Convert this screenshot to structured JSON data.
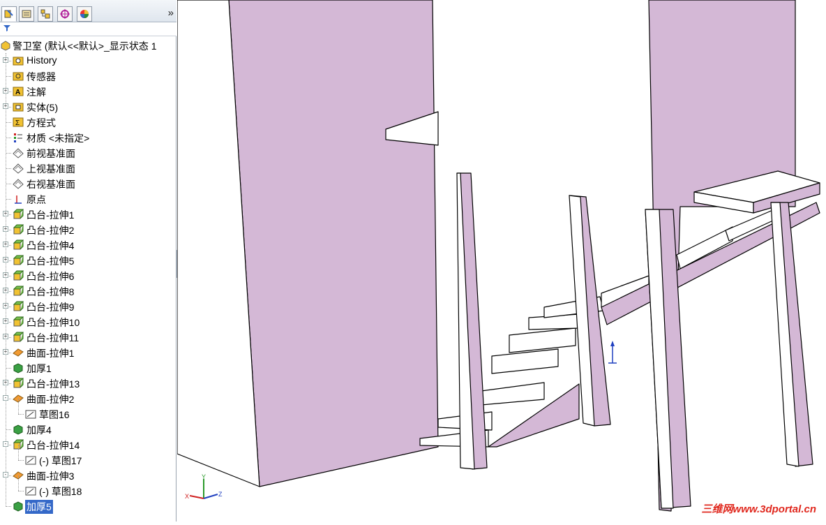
{
  "tabs": [
    "feature-manager",
    "property-manager",
    "configuration-manager",
    "dimxpert-manager",
    "display-manager"
  ],
  "tab_overflow": "»",
  "tree": {
    "root": "警卫室  (默认<<默认>_显示状态 1",
    "items": [
      {
        "label": "History",
        "icon": "history-folder-icon",
        "expand": "+"
      },
      {
        "label": "传感器",
        "icon": "sensors-folder-icon",
        "expand": ""
      },
      {
        "label": "注解",
        "icon": "annotations-folder-icon",
        "expand": "+"
      },
      {
        "label": "实体(5)",
        "icon": "solid-bodies-folder-icon",
        "expand": "+"
      },
      {
        "label": "方程式",
        "icon": "equations-folder-icon",
        "expand": ""
      },
      {
        "label": "材质 <未指定>",
        "icon": "material-icon",
        "expand": ""
      },
      {
        "label": "前视基准面",
        "icon": "plane-icon",
        "expand": ""
      },
      {
        "label": "上视基准面",
        "icon": "plane-icon",
        "expand": ""
      },
      {
        "label": "右视基准面",
        "icon": "plane-icon",
        "expand": ""
      },
      {
        "label": "原点",
        "icon": "origin-icon",
        "expand": ""
      },
      {
        "label": "凸台-拉伸1",
        "icon": "extrude-icon",
        "expand": "+"
      },
      {
        "label": "凸台-拉伸2",
        "icon": "extrude-icon",
        "expand": "+"
      },
      {
        "label": "凸台-拉伸4",
        "icon": "extrude-icon",
        "expand": "+"
      },
      {
        "label": "凸台-拉伸5",
        "icon": "extrude-icon",
        "expand": "+"
      },
      {
        "label": "凸台-拉伸6",
        "icon": "extrude-icon",
        "expand": "+"
      },
      {
        "label": "凸台-拉伸8",
        "icon": "extrude-icon",
        "expand": "+"
      },
      {
        "label": "凸台-拉伸9",
        "icon": "extrude-icon",
        "expand": "+"
      },
      {
        "label": "凸台-拉伸10",
        "icon": "extrude-icon",
        "expand": "+"
      },
      {
        "label": "凸台-拉伸11",
        "icon": "extrude-icon",
        "expand": "+"
      },
      {
        "label": "曲面-拉伸1",
        "icon": "surface-extrude-icon",
        "expand": "+"
      },
      {
        "label": "加厚1",
        "icon": "thicken-icon",
        "expand": ""
      },
      {
        "label": "凸台-拉伸13",
        "icon": "extrude-icon",
        "expand": "+"
      },
      {
        "label": "曲面-拉伸2",
        "icon": "surface-extrude-icon",
        "expand": "-"
      },
      {
        "label": "草图16",
        "icon": "sketch-icon",
        "expand": "",
        "child": true
      },
      {
        "label": "加厚4",
        "icon": "thicken-icon",
        "expand": ""
      },
      {
        "label": "凸台-拉伸14",
        "icon": "extrude-icon",
        "expand": "-"
      },
      {
        "label": "(-) 草图17",
        "icon": "sketch-icon",
        "expand": "",
        "child": true
      },
      {
        "label": "曲面-拉伸3",
        "icon": "surface-extrude-icon",
        "expand": "-"
      },
      {
        "label": "(-) 草图18",
        "icon": "sketch-icon",
        "expand": "",
        "child": true
      },
      {
        "label": "加厚5",
        "icon": "thicken-icon",
        "expand": "",
        "selected": true
      }
    ]
  },
  "triad": {
    "x": "X",
    "y": "Y",
    "z": "Z"
  },
  "watermark": "三维网www.3dportal.cn",
  "colors": {
    "wall": "#d4b8d6",
    "accent": "#3468c8",
    "edge": "#000000"
  }
}
